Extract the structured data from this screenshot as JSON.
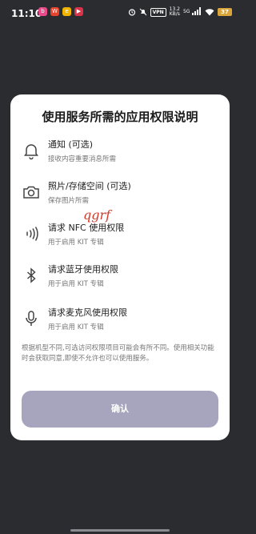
{
  "status_bar": {
    "time": "11:10",
    "vpn": "VPN",
    "net_speed_value": "13.2",
    "net_speed_unit": "KB/s",
    "network_type": "5G",
    "battery": "37",
    "app_icons": [
      "bilibili-icon",
      "weibo-icon",
      "browser-icon",
      "video-app-icon"
    ]
  },
  "dialog": {
    "title": "使用服务所需的应用权限说明",
    "items": [
      {
        "title": "通知 (可选)",
        "desc": "接收内容重要消息所需",
        "icon": "bell-icon"
      },
      {
        "title": "照片/存储空间 (可选)",
        "desc": "保存图片所需",
        "icon": "camera-icon"
      },
      {
        "title": "请求 NFC 使用权限",
        "desc": "用于启用 KIT 专辑",
        "icon": "nfc-icon"
      },
      {
        "title": "请求蓝牙使用权限",
        "desc": "用于启用 KIT 专辑",
        "icon": "bluetooth-icon"
      },
      {
        "title": "请求麦克风使用权限",
        "desc": "用于启用 KIT 专辑",
        "icon": "microphone-icon"
      }
    ],
    "note": "根据机型不同,可选访问权限项目可能会有所不同。使用相关功能时会获取同意,即使不允许也可以使用服务。",
    "confirm_label": "确认"
  },
  "watermark": "qgrf",
  "colors": {
    "background": "#2b2c30",
    "dialog": "#ffffff",
    "confirm_button": "#a7a4be",
    "battery": "#d9a43a",
    "watermark": "#d23a2a"
  }
}
